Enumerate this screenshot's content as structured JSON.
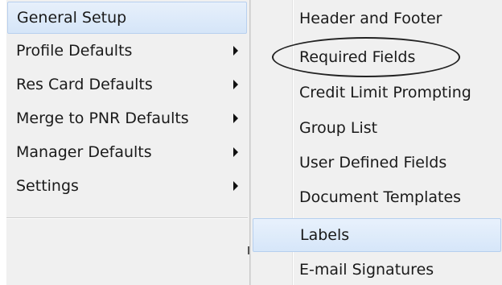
{
  "main_menu": {
    "items": [
      {
        "label": "General Setup"
      },
      {
        "label": "Profile Defaults"
      },
      {
        "label": "Res Card Defaults"
      },
      {
        "label": "Merge to PNR Defaults"
      },
      {
        "label": "Manager Defaults"
      },
      {
        "label": "Settings"
      }
    ]
  },
  "sub_menu": {
    "items": [
      {
        "label": "Header and Footer"
      },
      {
        "label": "Required Fields"
      },
      {
        "label": "Credit Limit Prompting"
      },
      {
        "label": "Group List"
      },
      {
        "label": "User Defined Fields"
      },
      {
        "label": "Document Templates"
      },
      {
        "label": "Labels"
      },
      {
        "label": "E-mail Signatures"
      }
    ]
  },
  "annotation": {
    "circled_item": "Required Fields",
    "ellipse_color": "#222222"
  },
  "colors": {
    "menu_background": "#f0f0f0",
    "highlight_background": "#dbe8f8",
    "highlight_border": "#b6cfee",
    "text": "#1a1a1a"
  },
  "icons": {
    "submenu_arrow": "triangle-right"
  }
}
